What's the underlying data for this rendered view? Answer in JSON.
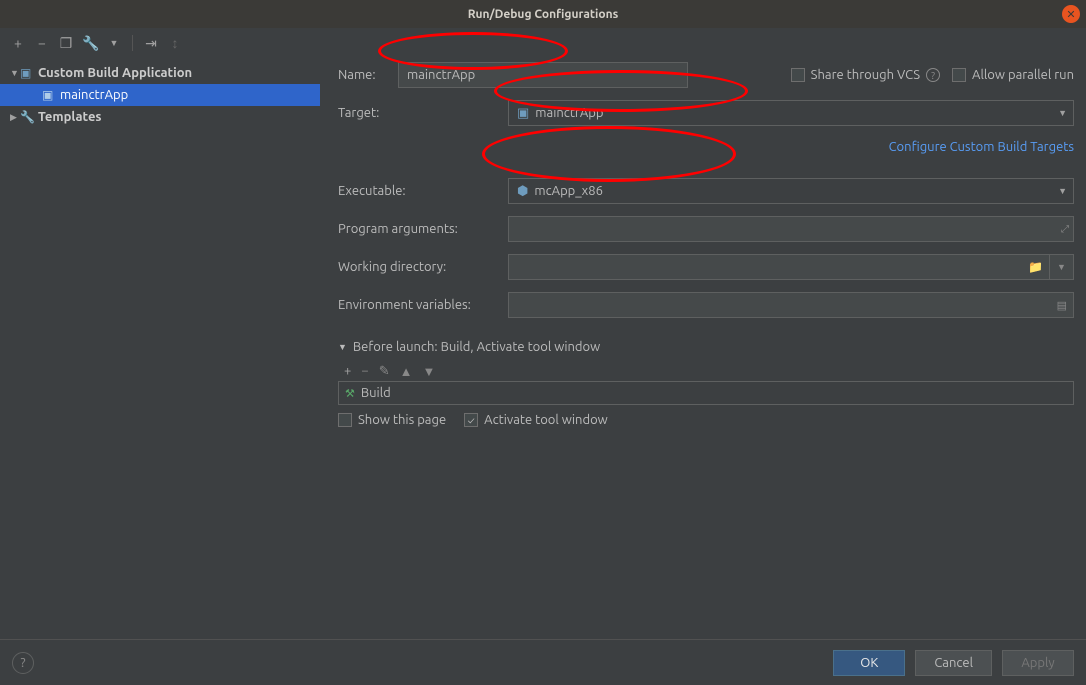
{
  "window": {
    "title": "Run/Debug Configurations"
  },
  "tree": {
    "custom_build": "Custom Build Application",
    "mainctr": "mainctrApp",
    "templates": "Templates"
  },
  "form": {
    "name_label": "Name:",
    "name_value": "mainctrApp",
    "share_vcs": "Share through VCS",
    "allow_parallel": "Allow parallel run",
    "target_label": "Target:",
    "target_value": "mainctrApp",
    "configure_link": "Configure Custom Build Targets",
    "executable_label": "Executable:",
    "executable_value": "mcApp_x86",
    "program_args_label": "Program arguments:",
    "working_dir_label": "Working directory:",
    "env_vars_label": "Environment variables:",
    "before_launch_title": "Before launch: Build, Activate tool window",
    "build_item": "Build",
    "show_this_page": "Show this page",
    "activate_tool_window": "Activate tool window"
  },
  "footer": {
    "ok": "OK",
    "cancel": "Cancel",
    "apply": "Apply"
  }
}
